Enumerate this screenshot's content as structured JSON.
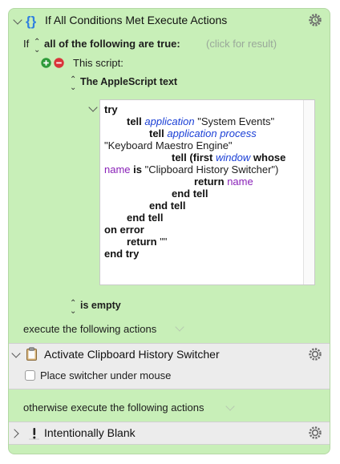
{
  "header": {
    "title": "If All Conditions Met Execute Actions"
  },
  "condition": {
    "if_label": "If",
    "match_mode": "all of the following are true:",
    "hint": "(click for result)",
    "script_label": "This script:",
    "script_type": "The AppleScript text",
    "result_test": "is empty"
  },
  "applescript": {
    "lines": [
      "try",
      "tell application \"System Events\"",
      "tell application process",
      "\"Keyboard Maestro Engine\"",
      "tell (first window whose",
      "name is \"Clipboard History Switcher\")",
      "return name",
      "end tell",
      "end tell",
      "end tell",
      "on error",
      "return \"\"",
      "end try"
    ],
    "tokens": {
      "try": "try",
      "tell": "tell",
      "application": "application",
      "system_events": "\"System Events\"",
      "application_process": "application process",
      "engine": "\"Keyboard Maestro Engine\"",
      "first": "(first",
      "window": "window",
      "whose": "whose",
      "name": "name",
      "is": "is",
      "switcher": "\"Clipboard History Switcher\")",
      "return": "return",
      "empty_string": "\"\"",
      "end_tell": "end tell",
      "on_error": "on error",
      "end_try": "end try"
    }
  },
  "then_actions": {
    "label": "execute the following actions",
    "items": [
      {
        "title": "Activate Clipboard History Switcher",
        "option_label": "Place switcher under mouse",
        "option_checked": false
      }
    ]
  },
  "else_actions": {
    "label": "otherwise execute the following actions",
    "items": [
      {
        "title": "Intentionally Blank"
      }
    ]
  },
  "colors": {
    "panel_bg": "#c8efb8",
    "action_bg": "#ececec",
    "keyword_blue": "#1a3fd6",
    "keyword_purple": "#8a22b8",
    "add_green": "#2e9b3a",
    "remove_red": "#d9343a",
    "braces_blue": "#2f7fe0"
  },
  "icons": [
    "chevron-down-icon",
    "braces-icon",
    "gear-icon",
    "up-down-arrows-icon",
    "plus-circle-icon",
    "minus-circle-icon",
    "clipboard-icon",
    "exclamation-icon",
    "chevron-right-icon"
  ]
}
